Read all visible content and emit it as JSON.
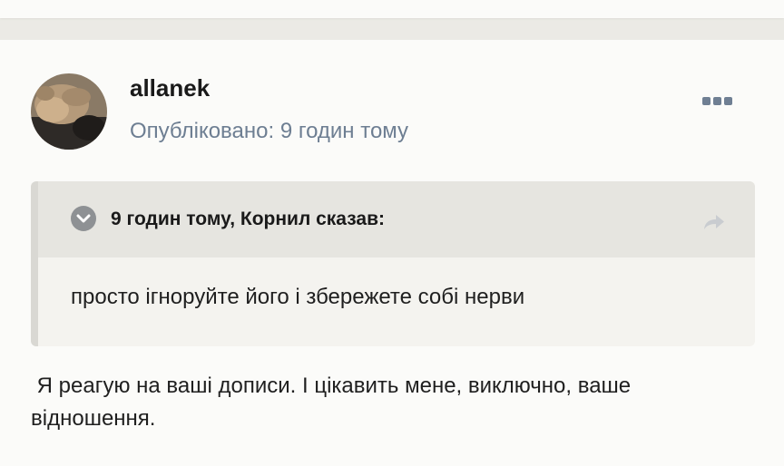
{
  "post": {
    "author": "allanek",
    "published": "Опубліковано: 9 годин тому",
    "more_icon": "more-dots-icon",
    "quote": {
      "citation": "9 годин тому, Корнил сказав:",
      "text": "просто ігноруйте його і збережете собі нерви",
      "toggle_icon": "chevron-down-icon",
      "share_icon": "share-arrow-icon"
    },
    "body": " Я реагую на ваші дописи. І цікавить мене, виключно, ваше відношення."
  },
  "colors": {
    "page_bg": "#ebeae5",
    "card_bg": "#fbfbf9",
    "meta_text": "#6d7e92",
    "quote_header_bg": "#e6e5e0",
    "quote_bg": "#f4f3ef"
  }
}
